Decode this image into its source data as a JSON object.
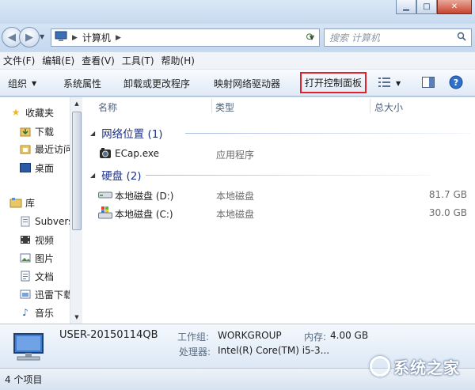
{
  "window": {
    "minimize": "▁",
    "maximize": "□",
    "close": "✕"
  },
  "address": {
    "root_icon": "computer-icon",
    "crumb": "计算机"
  },
  "search": {
    "placeholder": "搜索 计算机"
  },
  "menubar": [
    "文件(F)",
    "编辑(E)",
    "查看(V)",
    "工具(T)",
    "帮助(H)"
  ],
  "toolbar": {
    "organize": "组织",
    "system_properties": "系统属性",
    "uninstall": "卸载或更改程序",
    "map_drive": "映射网络驱动器",
    "control_panel": "打开控制面板"
  },
  "nav": {
    "favorites": "收藏夹",
    "downloads": "下载",
    "recent": "最近访问",
    "desktop": "桌面",
    "libraries": "库",
    "subversion": "Subvers",
    "videos": "视频",
    "pictures": "图片",
    "documents": "文档",
    "xunlei": "迅雷下载",
    "music": "音乐"
  },
  "columns": {
    "name": "名称",
    "type": "类型",
    "total_size": "总大小"
  },
  "groups": {
    "network": {
      "title": "网络位置 (1)",
      "items": [
        {
          "name": "ECap.exe",
          "type": "应用程序"
        }
      ]
    },
    "disks": {
      "title": "硬盘 (2)",
      "items": [
        {
          "name": "本地磁盘 (D:)",
          "type": "本地磁盘",
          "size": "81.7 GB"
        },
        {
          "name": "本地磁盘 (C:)",
          "type": "本地磁盘",
          "size": "30.0 GB"
        }
      ]
    }
  },
  "details": {
    "computer_name": "USER-20150114QB",
    "workgroup_label": "工作组:",
    "workgroup": "WORKGROUP",
    "memory_label": "内存:",
    "memory": "4.00 GB",
    "cpu_label": "处理器:",
    "cpu": "Intel(R) Core(TM) i5-3..."
  },
  "status": {
    "count": "4 个项目"
  },
  "watermark": "系统之家",
  "colors": {
    "highlight_box": "#e4212b",
    "group_text": "#1e3287"
  }
}
